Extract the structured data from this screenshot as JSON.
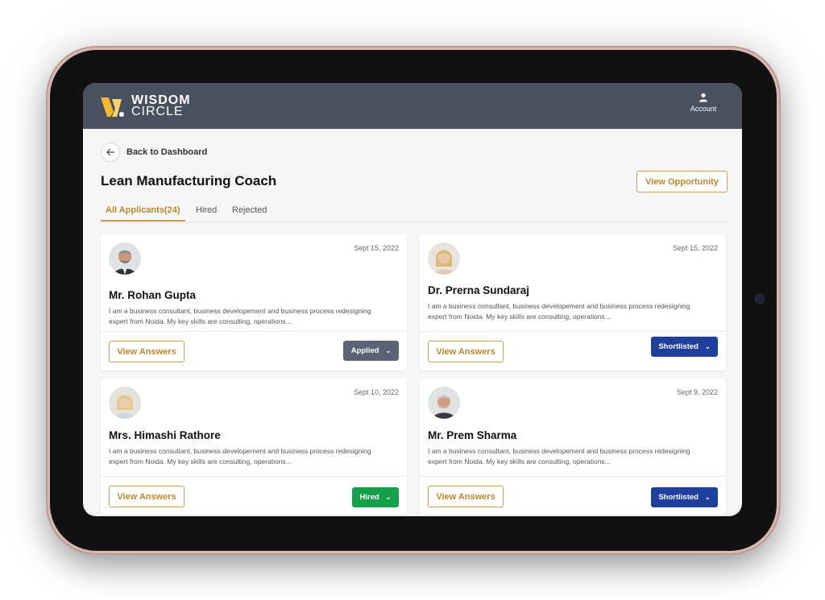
{
  "brand": {
    "line1": "WISDOM",
    "line2": "CIRCLE"
  },
  "header": {
    "account_label": "Account"
  },
  "nav": {
    "back_label": "Back to Dashboard"
  },
  "page": {
    "title": "Lean Manufacturing Coach",
    "view_opportunity_label": "View Opportunity"
  },
  "tabs": [
    {
      "label": "All Applicants(24)",
      "active": true
    },
    {
      "label": "Hired",
      "active": false
    },
    {
      "label": "Rejected",
      "active": false
    }
  ],
  "applicants": [
    {
      "name": "Mr. Rohan Gupta",
      "date": "Sept 15, 2022",
      "description": "I am a business consultant, business developement and business process redesigning expert from Noida. My key skills are consulting, operations...",
      "view_label": "View Answers",
      "status": "Applied",
      "status_color": "#5b6474"
    },
    {
      "name": "Dr. Prerna Sundaraj",
      "date": "Sept 15, 2022",
      "description": "I am a business consultant, business developement and business process redesigning expert from Noida. My key skills are consulting, operations...",
      "view_label": "View Answers",
      "status": "Shortlisted",
      "status_color": "#1f3f9d"
    },
    {
      "name": "Mrs. Himashi Rathore",
      "date": "Sept 10, 2022",
      "description": "I am a business consultant, business developement and business process redesigning expert from Noida. My key skills are consulting, operations...",
      "view_label": "View Answers",
      "status": "Hired",
      "status_color": "#17a04a"
    },
    {
      "name": "Mr. Prem Sharma",
      "date": "Sept 9, 2022",
      "description": "I am a business consultant, business developement and business process redesigning expert from Noida. My key skills are consulting, operations...",
      "view_label": "View Answers",
      "status": "Shortlisted",
      "status_color": "#1f3f9d"
    }
  ],
  "colors": {
    "accent": "#c8a24a",
    "header_bg": "#495060"
  }
}
